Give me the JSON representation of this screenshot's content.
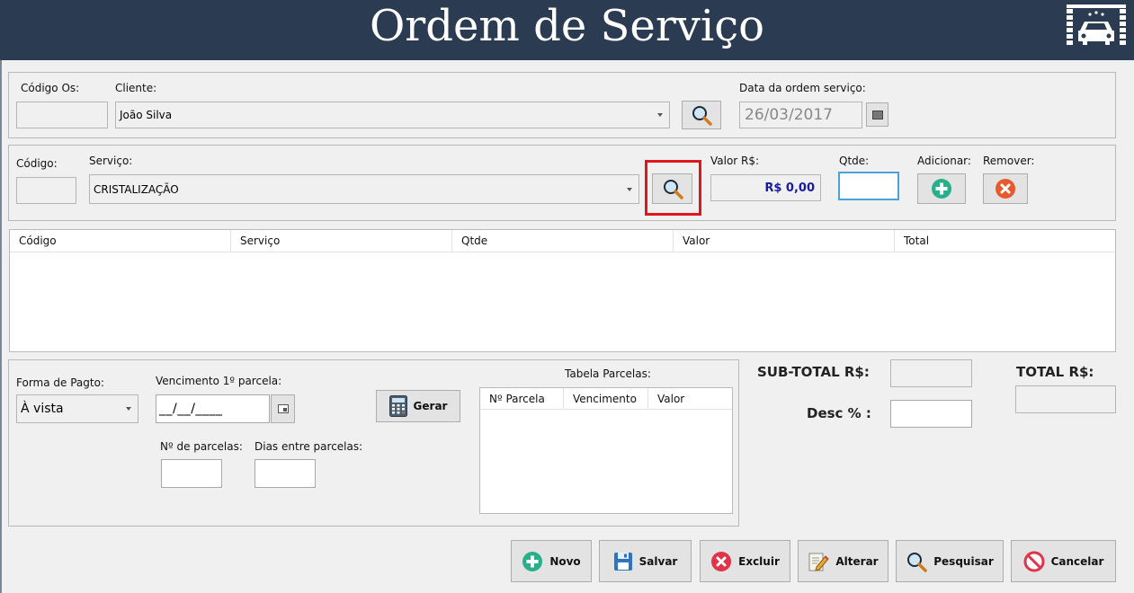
{
  "header": {
    "title": "Ordem de Serviço",
    "logo_icon": "car-wash-icon"
  },
  "os": {
    "codigo_label": "Código Os:",
    "codigo_value": "",
    "cliente_label": "Cliente:",
    "cliente_value": "João Silva",
    "data_label": "Data da ordem serviço:",
    "data_value": "26/03/2017"
  },
  "servico": {
    "codigo_label": "Código:",
    "codigo_value": "",
    "servico_label": "Serviço:",
    "servico_value": "CRISTALIZAÇÃO",
    "valor_label": "Valor R$:",
    "valor_value": "R$ 0,00",
    "qtde_label": "Qtde:",
    "qtde_value": "",
    "adicionar_label": "Adicionar:",
    "remover_label": "Remover:"
  },
  "items_table": {
    "columns": [
      "Código",
      "Serviço",
      "Qtde",
      "Valor",
      "Total"
    ],
    "rows": []
  },
  "pagamento": {
    "forma_label": "Forma de Pagto:",
    "forma_value": "À vista",
    "vencimento_label": "Vencimento 1º parcela:",
    "vencimento_value": "__/__/____",
    "gerar_label": "Gerar",
    "parcelas_label": "Nº de parcelas:",
    "parcelas_value": "",
    "dias_label": "Dias entre parcelas:",
    "dias_value": "",
    "tabela_title": "Tabela Parcelas:",
    "tabela_columns": [
      "Nº Parcela",
      "Vencimento",
      "Valor"
    ]
  },
  "totais": {
    "subtotal_label": "SUB-TOTAL R$:",
    "subtotal_value": "",
    "total_label": "TOTAL R$:",
    "total_value": "",
    "desc_label": "Desc % :",
    "desc_value": ""
  },
  "actions": {
    "novo": "Novo",
    "salvar": "Salvar",
    "excluir": "Excluir",
    "alterar": "Alterar",
    "pesquisar": "Pesquisar",
    "cancelar": "Cancelar"
  },
  "colors": {
    "header_bg": "#2b3c52",
    "value_blue": "#1a1a9c",
    "highlight_red": "#e0161c",
    "add_green": "#27b08a",
    "remove_orange": "#e8592c"
  }
}
